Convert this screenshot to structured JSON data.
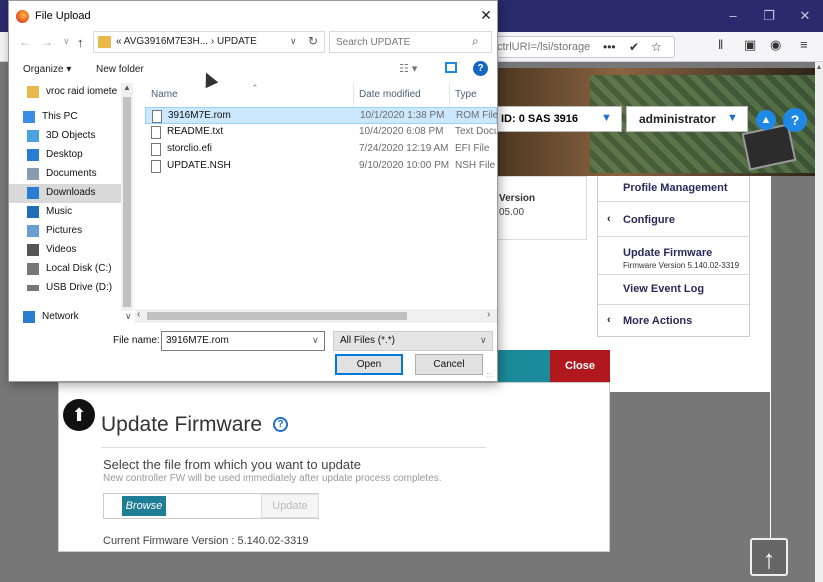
{
  "browser": {
    "url_fragment": "ctrlURI=/lsi/storage",
    "more_icon": "•••",
    "window_controls": [
      "–",
      "❐",
      "✕"
    ]
  },
  "app_header": {
    "controller": "ID: 0 SAS 3916",
    "user": "administrator"
  },
  "version_card": {
    "label": "Version",
    "value": "05.00"
  },
  "side_menu": {
    "items": [
      {
        "label": "Profile Management"
      },
      {
        "label": "Configure",
        "chevron": "‹"
      },
      {
        "label": "Update Firmware",
        "sub": "Firmware Version 5.140.02-3319"
      },
      {
        "label": "View Event Log"
      },
      {
        "label": "More Actions",
        "chevron": "‹"
      }
    ]
  },
  "fw_panel": {
    "close_label": "Close",
    "title": "Update Firmware",
    "prompt": "Select the file from which you want to update",
    "note": "New controller FW will be used immediately after update process completes.",
    "browse_label": "Browse",
    "update_label": "Update",
    "current_version": "Current Firmware Version : 5.140.02-3319"
  },
  "dialog": {
    "title": "File Upload",
    "address_path": "«  AVG3916M7E3H...  ›  UPDATE",
    "search_placeholder": "Search UPDATE",
    "organize_label": "Organize ▾",
    "new_folder_label": "New folder",
    "columns": {
      "name": "Name",
      "date": "Date modified",
      "type": "Type"
    },
    "nav_items": [
      {
        "label": "vroc raid iomete",
        "icon": "folder-icon",
        "color": "#e8b84a"
      },
      {
        "label": "This PC",
        "icon": "computer-icon",
        "color": "#3a8ee6"
      },
      {
        "label": "3D Objects",
        "icon": "cube-icon",
        "color": "#4aa3df"
      },
      {
        "label": "Desktop",
        "icon": "desktop-icon",
        "color": "#2b7cd3"
      },
      {
        "label": "Documents",
        "icon": "document-icon",
        "color": "#8a9bb0"
      },
      {
        "label": "Downloads",
        "icon": "download-icon",
        "color": "#2b7cd3"
      },
      {
        "label": "Music",
        "icon": "music-icon",
        "color": "#1f6fb5"
      },
      {
        "label": "Pictures",
        "icon": "picture-icon",
        "color": "#6a9fd4"
      },
      {
        "label": "Videos",
        "icon": "video-icon",
        "color": "#555"
      },
      {
        "label": "Local Disk (C:)",
        "icon": "disk-icon",
        "color": "#777"
      },
      {
        "label": "USB Drive (D:)",
        "icon": "usb-drive-icon",
        "color": "#777"
      },
      {
        "label": "Network",
        "icon": "network-icon",
        "color": "#2b7cd3"
      }
    ],
    "files": [
      {
        "name": "3916M7E.rom",
        "date": "10/1/2020 1:38 PM",
        "type": "ROM File"
      },
      {
        "name": "README.txt",
        "date": "10/4/2020 6:08 PM",
        "type": "Text Docu"
      },
      {
        "name": "storclio.efi",
        "date": "7/24/2020 12:19 AM",
        "type": "EFI File"
      },
      {
        "name": "UPDATE.NSH",
        "date": "9/10/2020 10:00 PM",
        "type": "NSH File"
      }
    ],
    "file_name_label": "File name:",
    "file_name_value": "3916M7E.rom",
    "file_type_value": "All Files (*.*)",
    "open_label": "Open",
    "cancel_label": "Cancel"
  }
}
